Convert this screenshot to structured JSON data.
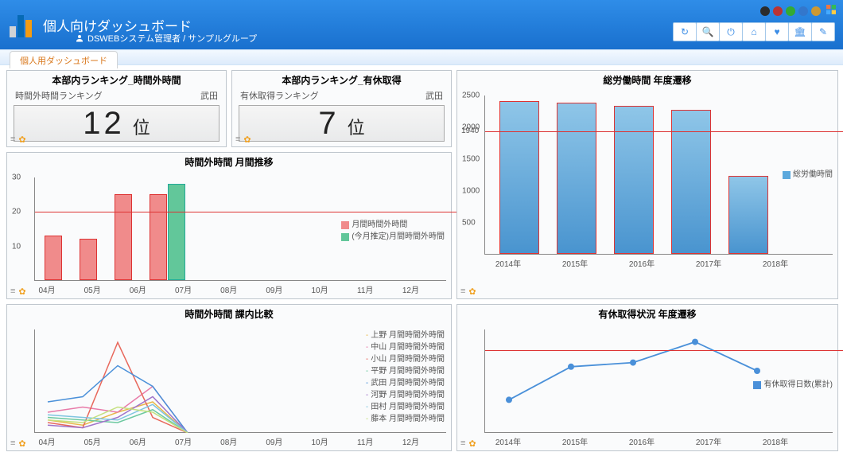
{
  "header": {
    "title": "個人向けダッシュボード",
    "user": "DSWEBシステム管理者 / サンプルグループ"
  },
  "dots": [
    "#2b2b2b",
    "#b33",
    "#3a3",
    "#37c",
    "#c93"
  ],
  "tab": "個人用ダッシュボード",
  "ranks": [
    {
      "title": "本部内ランキング_時間外時間",
      "label": "時間外時間ランキング",
      "person": "武田",
      "value": "12",
      "unit": "位"
    },
    {
      "title": "本部内ランキング_有休取得",
      "label": "有休取得ランキング",
      "person": "武田",
      "value": "7",
      "unit": "位"
    }
  ],
  "overtime": {
    "title": "時間外時間 月間推移",
    "yticks": [
      10,
      20,
      30
    ],
    "xcats": [
      "04月",
      "05月",
      "06月",
      "07月",
      "08月",
      "09月",
      "10月",
      "11月",
      "12月"
    ],
    "legend": [
      "月間時間外時間",
      "(今月推定)月間時間外時間"
    ],
    "ref": 20
  },
  "section_compare": {
    "title": "時間外時間 課内比較",
    "xcats": [
      "04月",
      "05月",
      "06月",
      "07月",
      "08月",
      "09月",
      "10月",
      "11月",
      "12月"
    ],
    "legend": [
      "上野 月間時間外時間",
      "中山 月間時間外時間",
      "小山 月間時間外時間",
      "平野 月間時間外時間",
      "武田 月間時間外時間",
      "河野 月間時間外時間",
      "田村 月間時間外時間",
      "藤本 月間時間外時間"
    ]
  },
  "total_hours": {
    "title": "総労働時間 年度遷移",
    "yticks": [
      500,
      1000,
      1500,
      2000,
      2500
    ],
    "ref": 1940,
    "xcats": [
      "2014年",
      "2015年",
      "2016年",
      "2017年",
      "2018年"
    ],
    "legend": "総労働時間"
  },
  "paid_leave": {
    "title": "有休取得状況 年度遷移",
    "xcats": [
      "2014年",
      "2015年",
      "2016年",
      "2017年",
      "2018年"
    ],
    "legend": "有休取得日数(累計)",
    "ref": 20
  },
  "chart_data": [
    {
      "type": "bar",
      "title": "時間外時間 月間推移",
      "categories": [
        "04月",
        "05月",
        "06月",
        "07月",
        "08月",
        "09月",
        "10月",
        "11月",
        "12月"
      ],
      "series": [
        {
          "name": "月間時間外時間",
          "values": [
            13,
            12,
            25,
            25,
            null,
            null,
            null,
            null,
            null
          ],
          "color": "#f08b8b"
        },
        {
          "name": "(今月推定)月間時間外時間",
          "values": [
            null,
            null,
            null,
            28,
            null,
            null,
            null,
            null,
            null
          ],
          "color": "#62c79a"
        }
      ],
      "ylim": [
        0,
        30
      ],
      "reference_line": 20
    },
    {
      "type": "line",
      "title": "時間外時間 課内比較",
      "categories": [
        "04月",
        "05月",
        "06月",
        "07月",
        "08月",
        "09月",
        "10月",
        "11月",
        "12月"
      ],
      "series": [
        {
          "name": "上野",
          "values": [
            5,
            3,
            8,
            12,
            0,
            null,
            null,
            null,
            null
          ]
        },
        {
          "name": "中山",
          "values": [
            8,
            10,
            8,
            18,
            0,
            null,
            null,
            null,
            null
          ]
        },
        {
          "name": "小山",
          "values": [
            4,
            2,
            35,
            6,
            0,
            null,
            null,
            null,
            null
          ]
        },
        {
          "name": "平野",
          "values": [
            6,
            5,
            4,
            9,
            0,
            null,
            null,
            null,
            null
          ]
        },
        {
          "name": "武田",
          "values": [
            12,
            14,
            26,
            18,
            0,
            null,
            null,
            null,
            null
          ]
        },
        {
          "name": "河野",
          "values": [
            3,
            2,
            6,
            14,
            0,
            null,
            null,
            null,
            null
          ]
        },
        {
          "name": "田村",
          "values": [
            7,
            6,
            5,
            11,
            0,
            null,
            null,
            null,
            null
          ]
        },
        {
          "name": "藤本",
          "values": [
            5,
            4,
            10,
            8,
            0,
            null,
            null,
            null,
            null
          ]
        }
      ]
    },
    {
      "type": "bar",
      "title": "総労働時間 年度遷移",
      "categories": [
        "2014年",
        "2015年",
        "2016年",
        "2017年",
        "2018年"
      ],
      "series": [
        {
          "name": "総労働時間",
          "values": [
            2400,
            2380,
            2320,
            2260,
            1220
          ],
          "color": "#5ca9dd"
        }
      ],
      "ylim": [
        0,
        2500
      ],
      "reference_line": 1940
    },
    {
      "type": "line",
      "title": "有休取得状況 年度遷移",
      "categories": [
        "2014年",
        "2015年",
        "2016年",
        "2017年",
        "2018年"
      ],
      "series": [
        {
          "name": "有休取得日数(累計)",
          "values": [
            8,
            16,
            17,
            22,
            15
          ],
          "color": "#4a90d9"
        }
      ],
      "reference_line": 20
    }
  ]
}
